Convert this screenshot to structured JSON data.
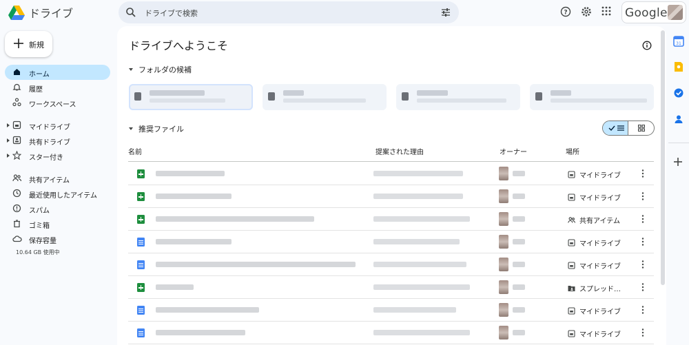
{
  "app": {
    "name": "ドライブ"
  },
  "search": {
    "placeholder": "ドライブで検索"
  },
  "account": {
    "brand": "Google"
  },
  "sidebar": {
    "new_label": "新規",
    "items": [
      {
        "label": "ホーム",
        "icon": "home-icon",
        "active": true
      },
      {
        "label": "履歴",
        "icon": "bell-icon"
      },
      {
        "label": "ワークスペース",
        "icon": "workspaces-icon"
      },
      {
        "label": "マイドライブ",
        "icon": "my-drive-icon"
      },
      {
        "label": "共有ドライブ",
        "icon": "shared-drive-icon"
      },
      {
        "label": "スター付き",
        "icon": "star-icon"
      },
      {
        "label": "共有アイテム",
        "icon": "people-icon"
      },
      {
        "label": "最近使用したアイテム",
        "icon": "clock-icon"
      },
      {
        "label": "スパム",
        "icon": "spam-icon"
      },
      {
        "label": "ゴミ箱",
        "icon": "trash-icon"
      },
      {
        "label": "保存容量",
        "icon": "cloud-icon"
      }
    ],
    "storage_text": "10.64 GB 使用中"
  },
  "main": {
    "title": "ドライブへようこそ",
    "folders_heading": "フォルダの候補",
    "files_heading": "推奨ファイル",
    "columns": {
      "name": "名前",
      "reason": "提案された理由",
      "owner": "オーナー",
      "location": "場所"
    },
    "rows": [
      {
        "type": "sheet",
        "location": "マイドライブ",
        "loc_icon": "my-drive-icon"
      },
      {
        "type": "sheet",
        "location": "マイドライブ",
        "loc_icon": "my-drive-icon"
      },
      {
        "type": "sheet",
        "location": "共有アイテム",
        "loc_icon": "people-icon"
      },
      {
        "type": "doc",
        "location": "マイドライブ",
        "loc_icon": "my-drive-icon"
      },
      {
        "type": "doc",
        "location": "マイドライブ",
        "loc_icon": "my-drive-icon"
      },
      {
        "type": "sheet",
        "location": "スプレッド…",
        "loc_icon": "shared-folder-icon"
      },
      {
        "type": "doc",
        "location": "マイドライブ",
        "loc_icon": "my-drive-icon"
      },
      {
        "type": "doc",
        "location": "マイドライブ",
        "loc_icon": "my-drive-icon"
      }
    ]
  },
  "colors": {
    "accent": "#c2e7ff",
    "sheet": "#1e8e3e",
    "doc": "#4285f4"
  }
}
